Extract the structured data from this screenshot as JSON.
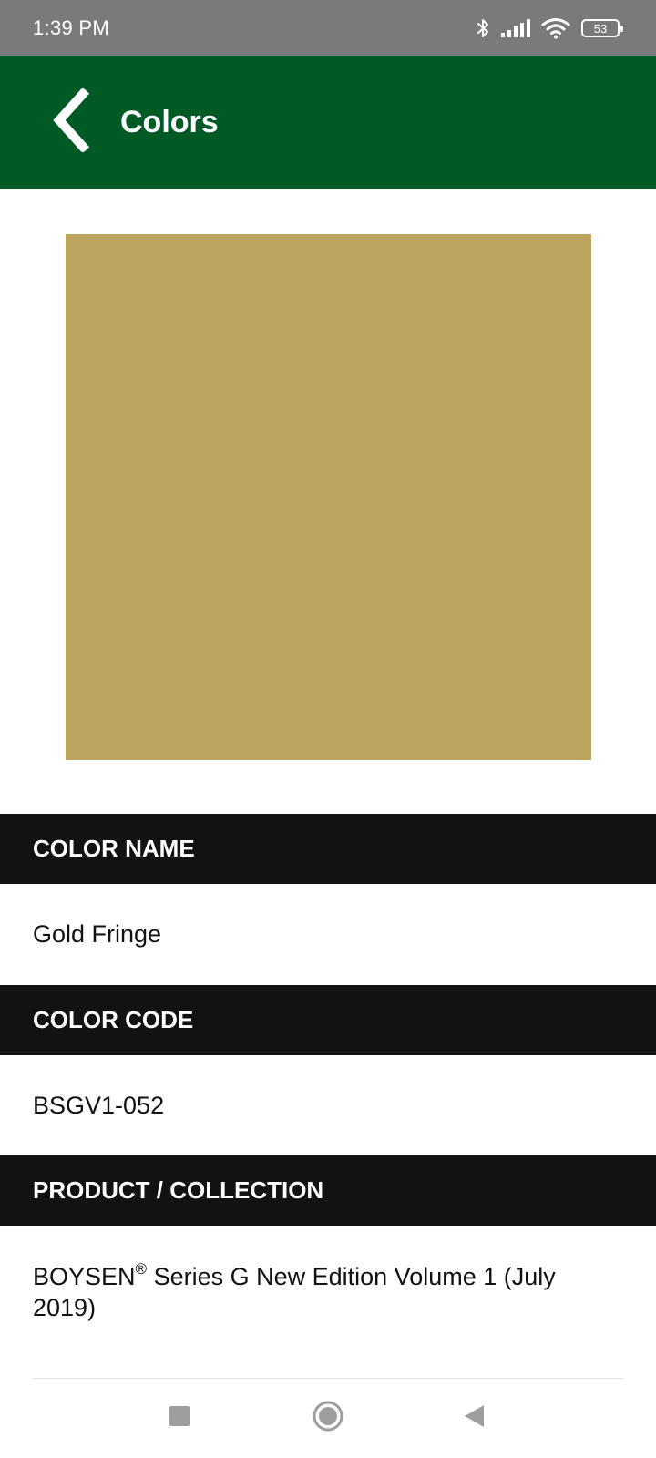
{
  "status_bar": {
    "time": "1:39 PM",
    "battery_level": "53",
    "icons": [
      "bluetooth-icon",
      "signal-icon",
      "wifi-icon",
      "battery-icon"
    ]
  },
  "app_bar": {
    "title": "Colors",
    "back_icon": "chevron-left-icon"
  },
  "swatch": {
    "color": "#bda45f"
  },
  "details": {
    "color_name_header": "COLOR NAME",
    "color_name": "Gold Fringe",
    "color_code_header": "COLOR CODE",
    "color_code": "BSGV1-052",
    "product_header": "PRODUCT / COLLECTION",
    "product_brand": "BOYSEN",
    "product_registered": "®",
    "product_rest": " Series G New Edition Volume 1 (July 2019)"
  },
  "nav_bar": {
    "icons": [
      "recents-icon",
      "home-icon",
      "back-icon"
    ]
  },
  "colors": {
    "status_bar": "#7a7a7a",
    "app_bar": "#005a25",
    "section_header": "#121212",
    "nav_icon": "#9e9e9e"
  }
}
